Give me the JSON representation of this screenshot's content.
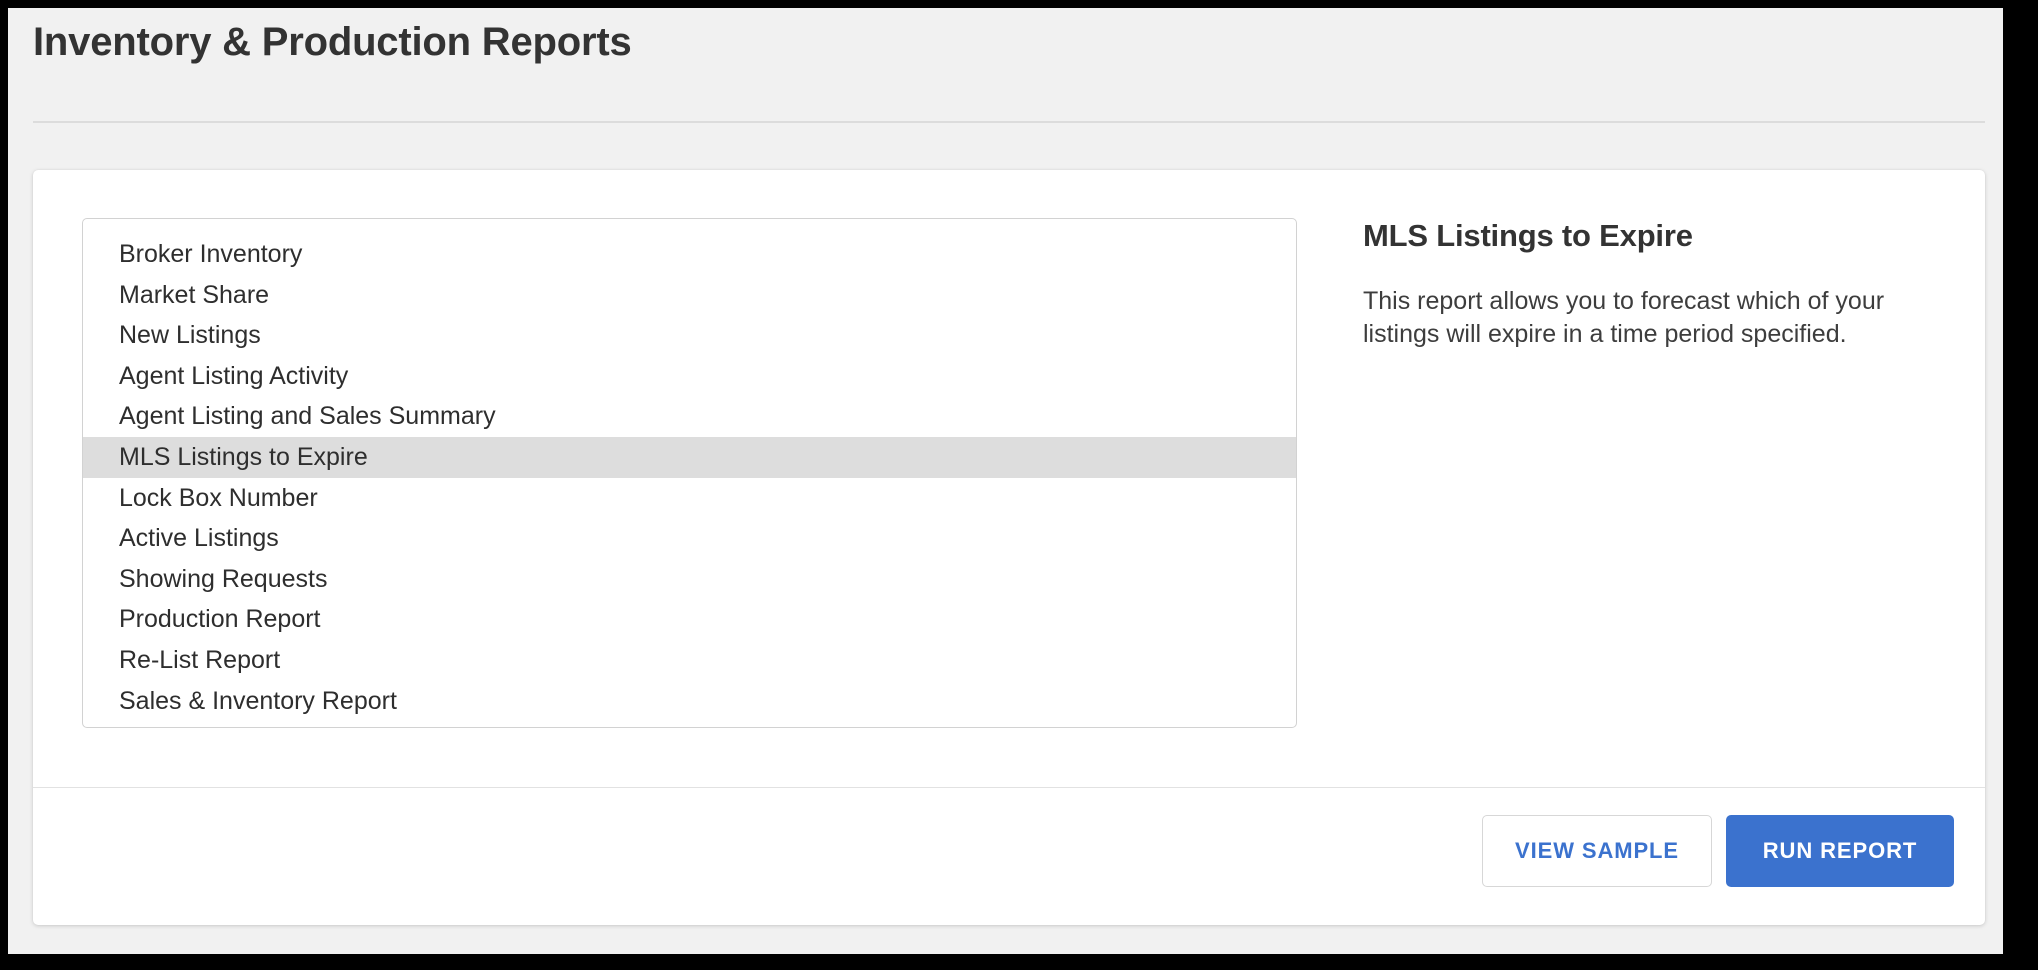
{
  "page": {
    "title": "Inventory & Production Reports",
    "background_color": "#f1f1f1",
    "card_background": "#ffffff"
  },
  "report_list": {
    "selected_index": 5,
    "selected_color": "#dddddd",
    "items": [
      {
        "label": "Broker Inventory"
      },
      {
        "label": "Market Share"
      },
      {
        "label": "New Listings"
      },
      {
        "label": "Agent Listing Activity"
      },
      {
        "label": "Agent Listing and Sales Summary"
      },
      {
        "label": "MLS Listings to Expire"
      },
      {
        "label": "Lock Box Number"
      },
      {
        "label": "Active Listings"
      },
      {
        "label": "Showing Requests"
      },
      {
        "label": "Production Report"
      },
      {
        "label": "Re-List Report"
      },
      {
        "label": "Sales & Inventory Report"
      }
    ]
  },
  "detail": {
    "title": "MLS Listings to Expire",
    "description": "This report allows you to forecast which of your listings will expire in a time period specified."
  },
  "footer": {
    "view_sample_label": "VIEW SAMPLE",
    "run_report_label": "RUN REPORT",
    "primary_color": "#3b72ce",
    "secondary_text_color": "#3b72ce"
  }
}
